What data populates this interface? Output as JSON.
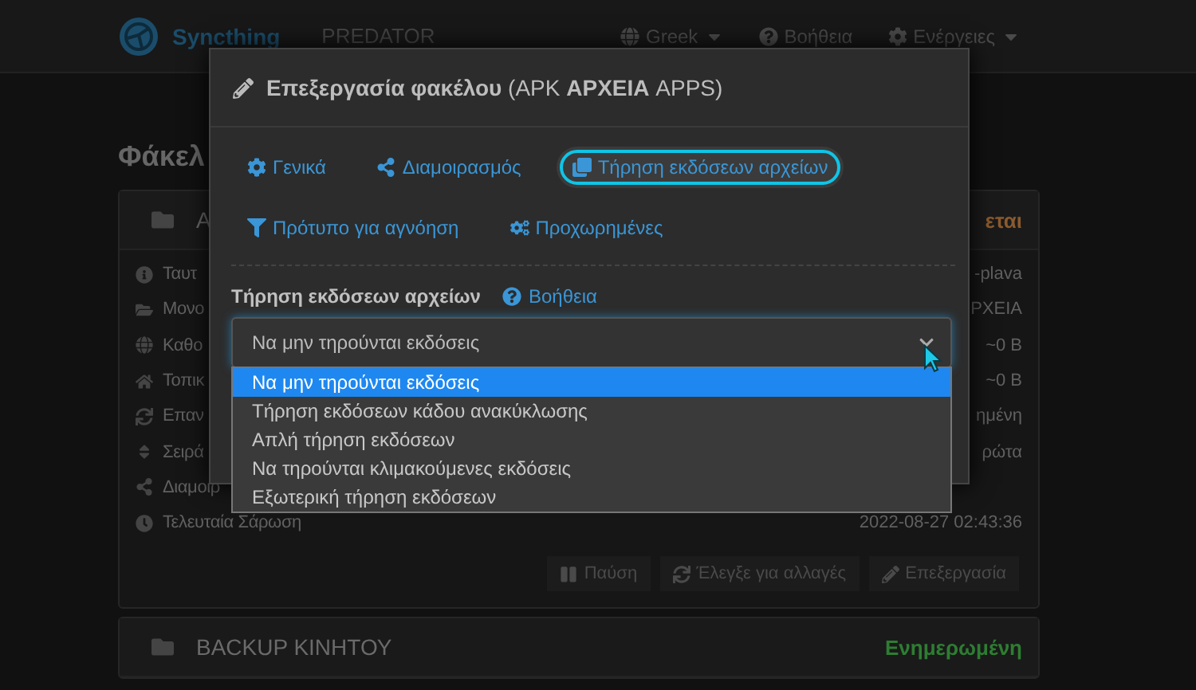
{
  "navbar": {
    "brand": "Syncthing",
    "device": "PREDATOR",
    "menus": [
      {
        "label": "Greek",
        "dropdown": true
      },
      {
        "label": "Βοήθεια",
        "dropdown": false
      },
      {
        "label": "Ενέργειες",
        "dropdown": true
      }
    ]
  },
  "page_title": "Φάκελ",
  "folders": [
    {
      "name": "A",
      "status": "εται",
      "color": "#8a5a2e",
      "rows": [
        {
          "label": "Ταυτ",
          "value": "-plava"
        },
        {
          "label": "Μονο",
          "value": "ΡΧΕΙΑ"
        },
        {
          "label": "Καθο",
          "value": "~0 B"
        },
        {
          "label": "Τοπικ",
          "value": "~0 B"
        },
        {
          "label": "Επαν",
          "value": "ημένη"
        },
        {
          "label": "Σειρά",
          "value": "ρώτα"
        },
        {
          "label": "Διαμοιρ"
        },
        {
          "label": "Τελευταία Σάρωση",
          "value": "2022-08-27 02:43:36"
        }
      ],
      "buttons": [
        "Παύση",
        "Έλεγξε για αλλαγές",
        "Επεξεργασία"
      ]
    },
    {
      "name": "BACKUP ΚΙΝΗΤΟΥ",
      "status": "Ενημερωμένη",
      "color": "#2e7d32"
    }
  ],
  "modal": {
    "title": "**Επεξεργασία φακέλου** (APK **ΑΡΧΕΙΑ** APPS)",
    "tabs": [
      {
        "label": "Γενικά",
        "selected": false
      },
      {
        "label": "Διαμοιρασμός",
        "selected": false
      },
      {
        "label": "Τήρηση εκδόσεων αρχείων",
        "selected": true
      },
      {
        "label": "Πρότυπο για αγνόηση",
        "selected": false
      },
      {
        "label": "Προχωρημένες",
        "selected": false
      }
    ],
    "field_label": "Τήρηση εκδόσεων αρχείων",
    "help_link": "Βοήθεια",
    "select": {
      "value": "Να μην τηρούνται εκδόσεις",
      "expanded": true
    },
    "options": [
      {
        "label": "Να μην τηρούνται εκδόσεις",
        "selected": true
      },
      {
        "label": "Τήρηση εκδόσεων κάδου ανακύκλωσης",
        "selected": false
      },
      {
        "label": "Απλή τήρηση εκδόσεων",
        "selected": false
      },
      {
        "label": "Να τηρούνται κλιμακούμενες εκδόσεις",
        "selected": false
      },
      {
        "label": "Εξωτερική τήρηση εκδόσεων",
        "selected": false
      }
    ]
  }
}
